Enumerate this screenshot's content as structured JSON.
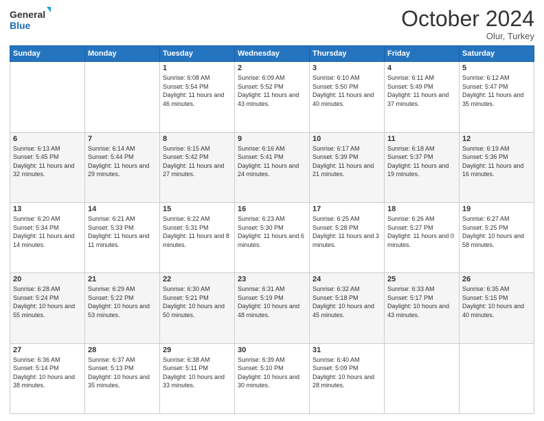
{
  "header": {
    "logo_line1": "General",
    "logo_line2": "Blue",
    "month_title": "October 2024",
    "location": "Olur, Turkey"
  },
  "weekdays": [
    "Sunday",
    "Monday",
    "Tuesday",
    "Wednesday",
    "Thursday",
    "Friday",
    "Saturday"
  ],
  "rows": [
    [
      null,
      null,
      {
        "day": 1,
        "sunrise": "Sunrise: 6:08 AM",
        "sunset": "Sunset: 5:54 PM",
        "daylight": "Daylight: 11 hours and 46 minutes."
      },
      {
        "day": 2,
        "sunrise": "Sunrise: 6:09 AM",
        "sunset": "Sunset: 5:52 PM",
        "daylight": "Daylight: 11 hours and 43 minutes."
      },
      {
        "day": 3,
        "sunrise": "Sunrise: 6:10 AM",
        "sunset": "Sunset: 5:50 PM",
        "daylight": "Daylight: 11 hours and 40 minutes."
      },
      {
        "day": 4,
        "sunrise": "Sunrise: 6:11 AM",
        "sunset": "Sunset: 5:49 PM",
        "daylight": "Daylight: 11 hours and 37 minutes."
      },
      {
        "day": 5,
        "sunrise": "Sunrise: 6:12 AM",
        "sunset": "Sunset: 5:47 PM",
        "daylight": "Daylight: 11 hours and 35 minutes."
      }
    ],
    [
      {
        "day": 6,
        "sunrise": "Sunrise: 6:13 AM",
        "sunset": "Sunset: 5:45 PM",
        "daylight": "Daylight: 11 hours and 32 minutes."
      },
      {
        "day": 7,
        "sunrise": "Sunrise: 6:14 AM",
        "sunset": "Sunset: 5:44 PM",
        "daylight": "Daylight: 11 hours and 29 minutes."
      },
      {
        "day": 8,
        "sunrise": "Sunrise: 6:15 AM",
        "sunset": "Sunset: 5:42 PM",
        "daylight": "Daylight: 11 hours and 27 minutes."
      },
      {
        "day": 9,
        "sunrise": "Sunrise: 6:16 AM",
        "sunset": "Sunset: 5:41 PM",
        "daylight": "Daylight: 11 hours and 24 minutes."
      },
      {
        "day": 10,
        "sunrise": "Sunrise: 6:17 AM",
        "sunset": "Sunset: 5:39 PM",
        "daylight": "Daylight: 11 hours and 21 minutes."
      },
      {
        "day": 11,
        "sunrise": "Sunrise: 6:18 AM",
        "sunset": "Sunset: 5:37 PM",
        "daylight": "Daylight: 11 hours and 19 minutes."
      },
      {
        "day": 12,
        "sunrise": "Sunrise: 6:19 AM",
        "sunset": "Sunset: 5:36 PM",
        "daylight": "Daylight: 11 hours and 16 minutes."
      }
    ],
    [
      {
        "day": 13,
        "sunrise": "Sunrise: 6:20 AM",
        "sunset": "Sunset: 5:34 PM",
        "daylight": "Daylight: 11 hours and 14 minutes."
      },
      {
        "day": 14,
        "sunrise": "Sunrise: 6:21 AM",
        "sunset": "Sunset: 5:33 PM",
        "daylight": "Daylight: 11 hours and 11 minutes."
      },
      {
        "day": 15,
        "sunrise": "Sunrise: 6:22 AM",
        "sunset": "Sunset: 5:31 PM",
        "daylight": "Daylight: 11 hours and 8 minutes."
      },
      {
        "day": 16,
        "sunrise": "Sunrise: 6:23 AM",
        "sunset": "Sunset: 5:30 PM",
        "daylight": "Daylight: 11 hours and 6 minutes."
      },
      {
        "day": 17,
        "sunrise": "Sunrise: 6:25 AM",
        "sunset": "Sunset: 5:28 PM",
        "daylight": "Daylight: 11 hours and 3 minutes."
      },
      {
        "day": 18,
        "sunrise": "Sunrise: 6:26 AM",
        "sunset": "Sunset: 5:27 PM",
        "daylight": "Daylight: 11 hours and 0 minutes."
      },
      {
        "day": 19,
        "sunrise": "Sunrise: 6:27 AM",
        "sunset": "Sunset: 5:25 PM",
        "daylight": "Daylight: 10 hours and 58 minutes."
      }
    ],
    [
      {
        "day": 20,
        "sunrise": "Sunrise: 6:28 AM",
        "sunset": "Sunset: 5:24 PM",
        "daylight": "Daylight: 10 hours and 55 minutes."
      },
      {
        "day": 21,
        "sunrise": "Sunrise: 6:29 AM",
        "sunset": "Sunset: 5:22 PM",
        "daylight": "Daylight: 10 hours and 53 minutes."
      },
      {
        "day": 22,
        "sunrise": "Sunrise: 6:30 AM",
        "sunset": "Sunset: 5:21 PM",
        "daylight": "Daylight: 10 hours and 50 minutes."
      },
      {
        "day": 23,
        "sunrise": "Sunrise: 6:31 AM",
        "sunset": "Sunset: 5:19 PM",
        "daylight": "Daylight: 10 hours and 48 minutes."
      },
      {
        "day": 24,
        "sunrise": "Sunrise: 6:32 AM",
        "sunset": "Sunset: 5:18 PM",
        "daylight": "Daylight: 10 hours and 45 minutes."
      },
      {
        "day": 25,
        "sunrise": "Sunrise: 6:33 AM",
        "sunset": "Sunset: 5:17 PM",
        "daylight": "Daylight: 10 hours and 43 minutes."
      },
      {
        "day": 26,
        "sunrise": "Sunrise: 6:35 AM",
        "sunset": "Sunset: 5:15 PM",
        "daylight": "Daylight: 10 hours and 40 minutes."
      }
    ],
    [
      {
        "day": 27,
        "sunrise": "Sunrise: 6:36 AM",
        "sunset": "Sunset: 5:14 PM",
        "daylight": "Daylight: 10 hours and 38 minutes."
      },
      {
        "day": 28,
        "sunrise": "Sunrise: 6:37 AM",
        "sunset": "Sunset: 5:13 PM",
        "daylight": "Daylight: 10 hours and 35 minutes."
      },
      {
        "day": 29,
        "sunrise": "Sunrise: 6:38 AM",
        "sunset": "Sunset: 5:11 PM",
        "daylight": "Daylight: 10 hours and 33 minutes."
      },
      {
        "day": 30,
        "sunrise": "Sunrise: 6:39 AM",
        "sunset": "Sunset: 5:10 PM",
        "daylight": "Daylight: 10 hours and 30 minutes."
      },
      {
        "day": 31,
        "sunrise": "Sunrise: 6:40 AM",
        "sunset": "Sunset: 5:09 PM",
        "daylight": "Daylight: 10 hours and 28 minutes."
      },
      null,
      null
    ]
  ]
}
